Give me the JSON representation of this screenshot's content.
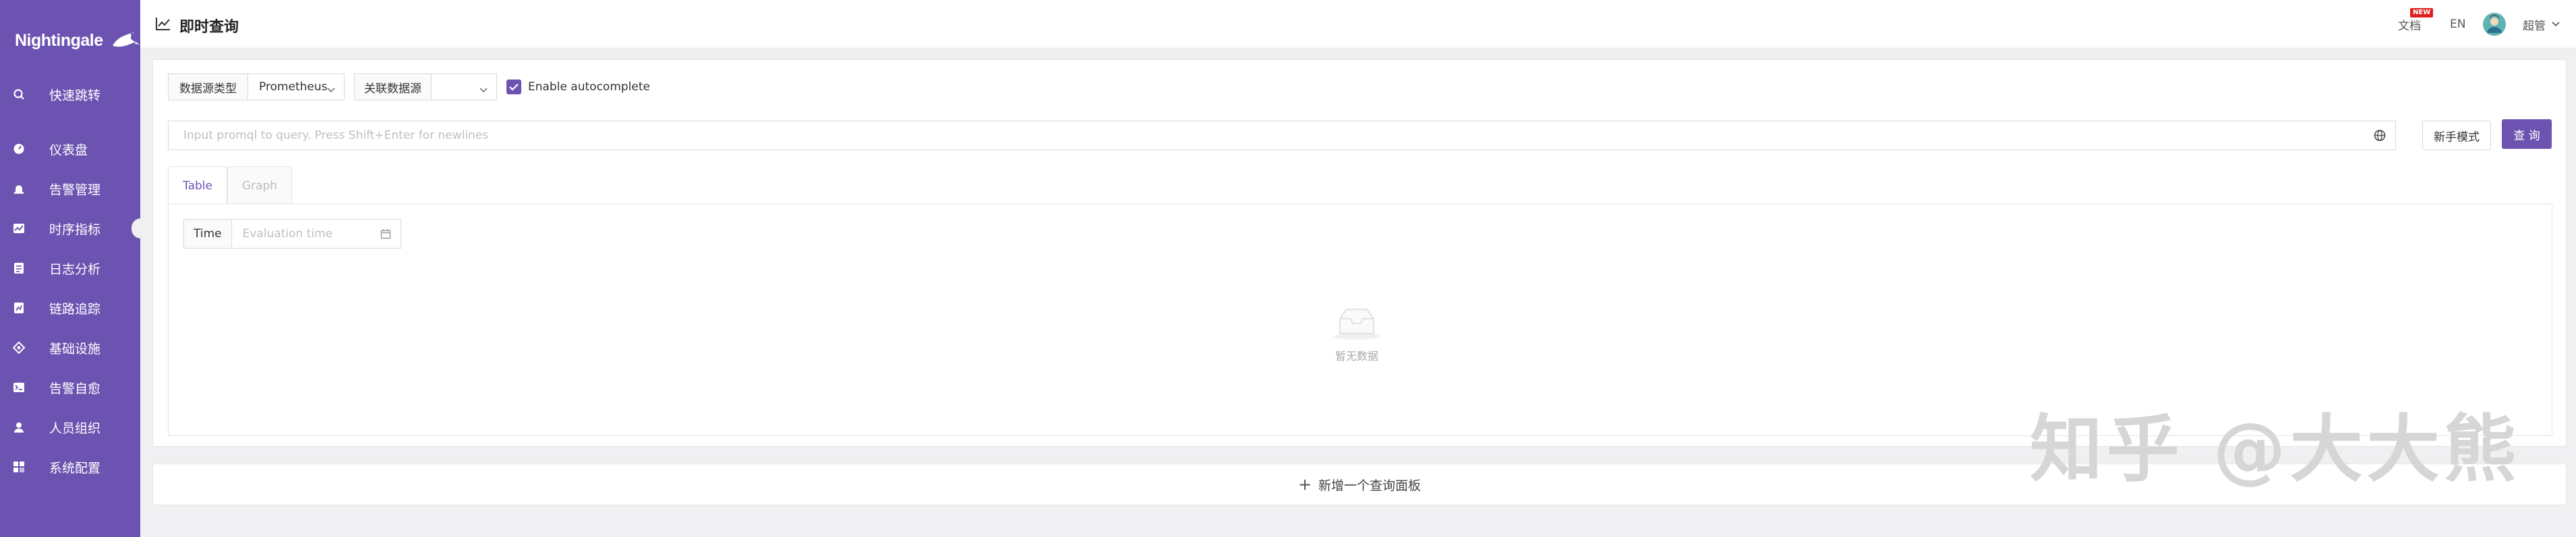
{
  "app": {
    "logo_text": "Nightingale",
    "page_title": "即时查询",
    "brand_color": "#6c53b1"
  },
  "sidebar": {
    "items": [
      {
        "label": "快速跳转",
        "icon": "search-icon"
      },
      {
        "label": "仪表盘",
        "icon": "dashboard-icon"
      },
      {
        "label": "告警管理",
        "icon": "alarm-icon"
      },
      {
        "label": "时序指标",
        "icon": "metric-icon",
        "active": true
      },
      {
        "label": "日志分析",
        "icon": "log-icon"
      },
      {
        "label": "链路追踪",
        "icon": "trace-icon"
      },
      {
        "label": "基础设施",
        "icon": "infra-icon"
      },
      {
        "label": "告警自愈",
        "icon": "self-heal-icon"
      },
      {
        "label": "人员组织",
        "icon": "user-icon"
      },
      {
        "label": "系统配置",
        "icon": "settings-icon"
      }
    ]
  },
  "header": {
    "docs_label": "文档",
    "docs_badge": "NEW",
    "lang_label": "EN",
    "user_name": "超管"
  },
  "query": {
    "datasource_type_label": "数据源类型",
    "datasource_type_value": "Prometheus",
    "linked_source_label": "关联数据源",
    "autocomplete_label": "Enable autocomplete",
    "input_placeholder": "Input promql to query. Press Shift+Enter for newlines",
    "novice_mode_label": "新手模式",
    "query_button_label": "查 询"
  },
  "tabs": [
    {
      "label": "Table",
      "active": true
    },
    {
      "label": "Graph",
      "active": false
    }
  ],
  "table_view": {
    "time_label": "Time",
    "time_placeholder": "Evaluation time",
    "empty_text": "暂无数据"
  },
  "add_panel_label": "新增一个查询面板",
  "watermark": "知乎 @大大熊"
}
